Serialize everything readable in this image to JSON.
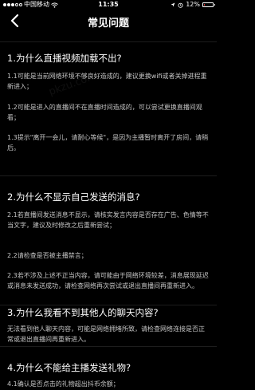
{
  "status_bar": {
    "carrier": "中国移动",
    "time": "11:35",
    "battery": "12%",
    "battery_level": 0.12
  },
  "nav": {
    "title": "常见问题"
  },
  "faq": [
    {
      "question": "1.为什么直播视频加载不出?",
      "answers": [
        "1.1可能是当前网络环境不够良好造成的，建议更换wifi或者关掉进程重新进入；",
        "1.2可能是进入的直播间不在直播时间造成的，可以尝试更换直播间观看；",
        "1.3提示\"离开一会儿，请耐心等候\"，是因为主播暂时离开了房间，请稍后。"
      ]
    },
    {
      "question": "2.为什么不显示自己发送的消息?",
      "answers": [
        "2.1若直播间发送消息不显示，请核实发言内容是否存在广告、色情等不当文字，建议及时修改之后重新尝试；",
        "2.2请检查是否被主播禁言；",
        "2.3若不涉及上述不正当内容，请可能由于网络环境较差，消息展现延迟或消息未发送成功，请检查网络再次尝试或退出直播间再重新进入。"
      ]
    },
    {
      "question": "3.为什么我看不到其他人的聊天内容?",
      "answers": [
        "无法看到他人聊天内容，可能是网络拥堵所致，请检查网络连接是否正常或退出直播间再重新进入。"
      ]
    },
    {
      "question": "4.为什么不能给主播发送礼物?",
      "answers": [
        "4.1确认是否点击的礼物超出抖币余额；"
      ]
    }
  ]
}
